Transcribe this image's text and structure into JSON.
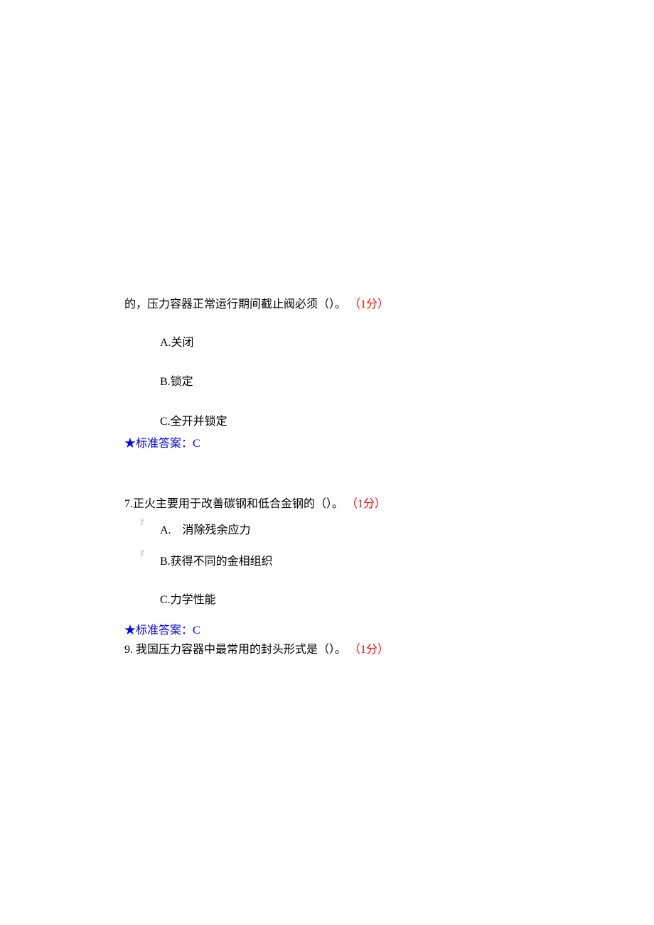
{
  "q6": {
    "stem_cont": "的，压力容器正常运行期间截止阀必须（）。",
    "score": "（1分）",
    "options": {
      "a": "A.关闭",
      "b": "B.锁定",
      "c": "C.全开并锁定"
    },
    "answer": "★标准答案：C"
  },
  "q7": {
    "stem": "7.正火主要用于改善碳钢和低合金钢的（）。",
    "score": "（1分）",
    "marker_a": "『",
    "marker_b": "『",
    "options": {
      "a": "A.　消除残余应力",
      "b": "B.获得不同的金相组织",
      "c": "C.力学性能"
    },
    "answer": "★标准答案：C"
  },
  "q9": {
    "stem": "9.  我国压力容器中最常用的封头形式是（）。",
    "score": "（1分）"
  }
}
